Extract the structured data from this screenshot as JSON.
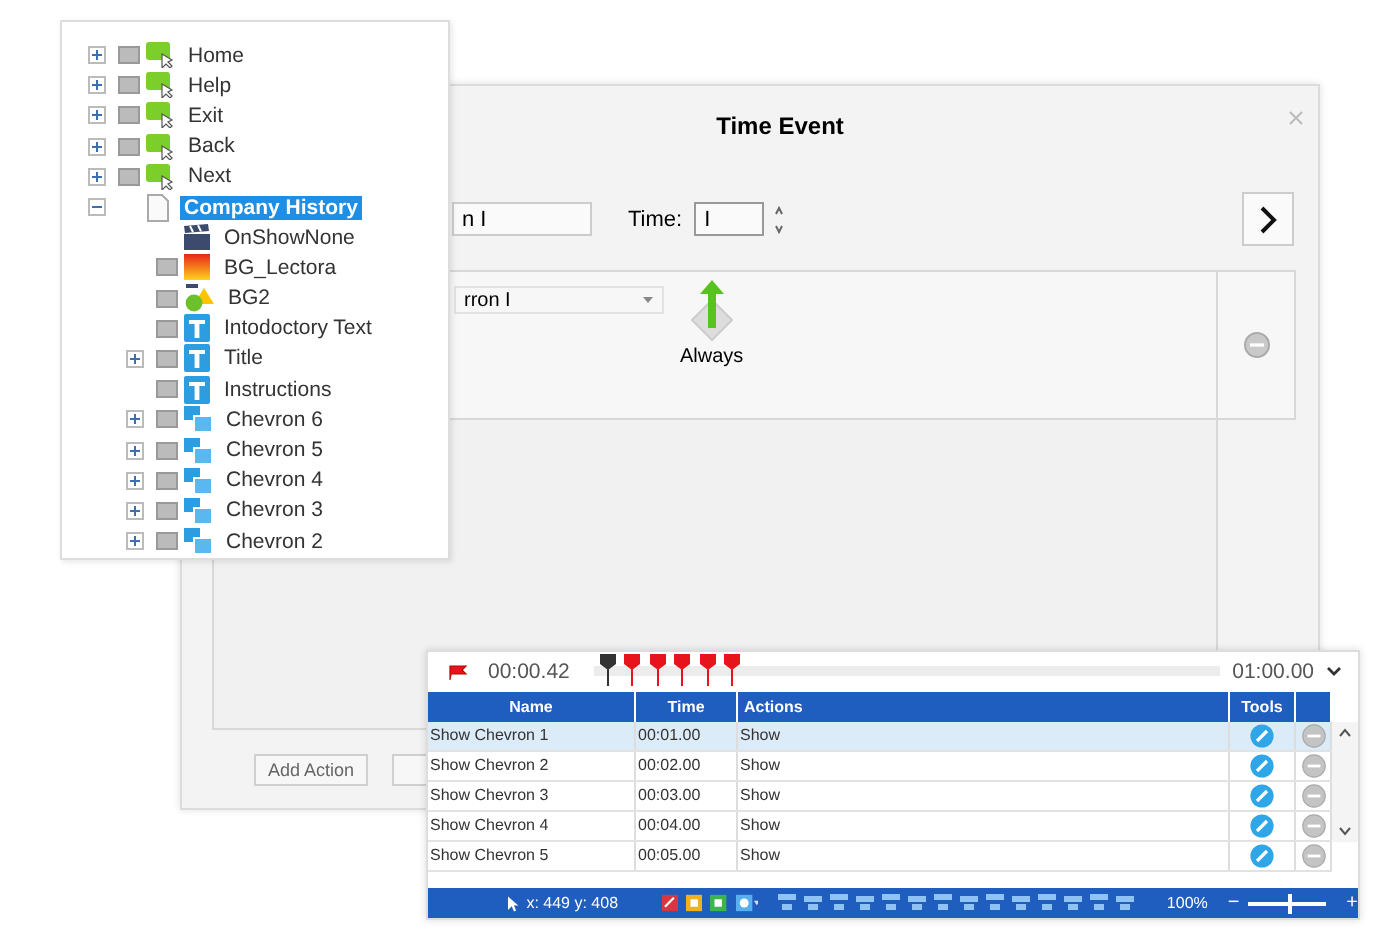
{
  "tree": {
    "items": [
      {
        "label": "Home",
        "kind": "button",
        "expanded": false,
        "selected": false
      },
      {
        "label": "Help",
        "kind": "button",
        "expanded": false,
        "selected": false
      },
      {
        "label": "Exit",
        "kind": "button",
        "expanded": false,
        "selected": false
      },
      {
        "label": "Back",
        "kind": "button",
        "expanded": false,
        "selected": false
      },
      {
        "label": "Next",
        "kind": "button",
        "expanded": false,
        "selected": false
      },
      {
        "label": "Company History",
        "kind": "page",
        "expanded": true,
        "selected": true,
        "children": [
          {
            "label": "OnShowNone",
            "kind": "action",
            "selected": false
          },
          {
            "label": "BG_Lectora",
            "kind": "image",
            "selected": false
          },
          {
            "label": "BG2",
            "kind": "shape",
            "selected": false
          },
          {
            "label": "Intodoctory Text",
            "kind": "text",
            "selected": false
          },
          {
            "label": "Title",
            "kind": "text",
            "expanded": false,
            "selected": false
          },
          {
            "label": "Instructions",
            "kind": "text",
            "selected": false
          },
          {
            "label": "Chevron 6",
            "kind": "group",
            "expanded": false,
            "selected": false
          },
          {
            "label": "Chevron 5",
            "kind": "group",
            "expanded": false,
            "selected": false
          },
          {
            "label": "Chevron 4",
            "kind": "group",
            "expanded": false,
            "selected": false
          },
          {
            "label": "Chevron 3",
            "kind": "group",
            "expanded": false,
            "selected": false
          },
          {
            "label": "Chevron 2",
            "kind": "group",
            "expanded": false,
            "selected": false
          }
        ]
      }
    ]
  },
  "dialog": {
    "title": "Time Event",
    "name_value": "n I",
    "time_label": "Time:",
    "time_value": "I",
    "target_value": "rron I",
    "trigger_label": "Always",
    "add_button": "Add Action"
  },
  "timeline": {
    "current_time": "00:00.42",
    "end_time": "01:00.00",
    "markers": [
      {
        "color": "#333333"
      },
      {
        "color": "#e8141b"
      },
      {
        "color": "#e8141b"
      },
      {
        "color": "#e8141b"
      },
      {
        "color": "#e8141b"
      },
      {
        "color": "#e8141b"
      }
    ],
    "columns": [
      "Name",
      "Time",
      "Actions",
      "Tools"
    ],
    "rows": [
      {
        "name": "Show Chevron 1",
        "time": "00:01.00",
        "action": "Show",
        "selected": true
      },
      {
        "name": "Show Chevron 2",
        "time": "00:02.00",
        "action": "Show",
        "selected": false
      },
      {
        "name": "Show Chevron 3",
        "time": "00:03.00",
        "action": "Show",
        "selected": false
      },
      {
        "name": "Show Chevron 4",
        "time": "00:04.00",
        "action": "Show",
        "selected": false
      },
      {
        "name": "Show Chevron 5",
        "time": "00:05.00",
        "action": "Show",
        "selected": false
      }
    ]
  },
  "status_bar": {
    "coordinates": "x: 449  y: 408",
    "zoom_label": "100%",
    "zoom_out": "−",
    "zoom_in": "+",
    "zoom": {
      "level": 0.55
    }
  }
}
